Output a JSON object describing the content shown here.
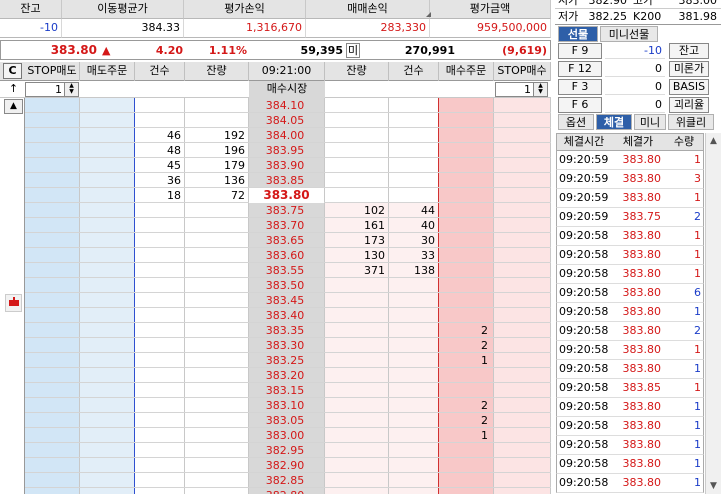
{
  "summary": {
    "headers": [
      "잔고",
      "이동평균가",
      "평가손익",
      "매매손익",
      "평가금액"
    ],
    "values": [
      "-10",
      "384.33",
      "1,316,670",
      "283,330",
      "959,500,000"
    ]
  },
  "price_line": {
    "price": "383.80",
    "arrow": "▲",
    "change": "4.20",
    "pct": "1.11%",
    "volume": "59,395",
    "volume_unit": "미",
    "open_interest": "270,991",
    "oi_change": "(9,619)"
  },
  "top_right": {
    "row1": [
      "시가",
      "382.90",
      "고가",
      "383.00"
    ],
    "row2": [
      "저가",
      "382.25",
      "K200",
      "381.98"
    ]
  },
  "order_table": {
    "c_button": "C",
    "headers": [
      "STOP매도",
      "매도주문",
      "건수",
      "잔량",
      "09:21:00",
      "잔량",
      "건수",
      "매수주문",
      "STOP매수"
    ],
    "stop_sell_qty": "1",
    "stop_buy_qty": "1",
    "market_label": "매수시장",
    "current_price": "383.80",
    "up_arrow": "↑",
    "triangle_up": "▲",
    "rows": [
      {
        "price": "384.10",
        "s_qty": "",
        "s_cnt": "",
        "b_qty": "",
        "b_cnt": "",
        "buy": ""
      },
      {
        "price": "384.05",
        "s_qty": "",
        "s_cnt": "",
        "b_qty": "",
        "b_cnt": "",
        "buy": ""
      },
      {
        "price": "384.00",
        "s_qty": "192",
        "s_cnt": "46",
        "b_qty": "",
        "b_cnt": "",
        "buy": ""
      },
      {
        "price": "383.95",
        "s_qty": "196",
        "s_cnt": "48",
        "b_qty": "",
        "b_cnt": "",
        "buy": ""
      },
      {
        "price": "383.90",
        "s_qty": "179",
        "s_cnt": "45",
        "b_qty": "",
        "b_cnt": "",
        "buy": ""
      },
      {
        "price": "383.85",
        "s_qty": "136",
        "s_cnt": "36",
        "b_qty": "",
        "b_cnt": "",
        "buy": ""
      },
      {
        "price": "383.80",
        "s_qty": "72",
        "s_cnt": "18",
        "b_qty": "",
        "b_cnt": "",
        "buy": ""
      },
      {
        "price": "383.75",
        "s_qty": "",
        "s_cnt": "",
        "b_qty": "102",
        "b_cnt": "44",
        "buy": ""
      },
      {
        "price": "383.70",
        "s_qty": "",
        "s_cnt": "",
        "b_qty": "161",
        "b_cnt": "40",
        "buy": ""
      },
      {
        "price": "383.65",
        "s_qty": "",
        "s_cnt": "",
        "b_qty": "173",
        "b_cnt": "30",
        "buy": ""
      },
      {
        "price": "383.60",
        "s_qty": "",
        "s_cnt": "",
        "b_qty": "130",
        "b_cnt": "33",
        "buy": ""
      },
      {
        "price": "383.55",
        "s_qty": "",
        "s_cnt": "",
        "b_qty": "371",
        "b_cnt": "138",
        "buy": ""
      },
      {
        "price": "383.50",
        "s_qty": "",
        "s_cnt": "",
        "b_qty": "",
        "b_cnt": "",
        "buy": ""
      },
      {
        "price": "383.45",
        "s_qty": "",
        "s_cnt": "",
        "b_qty": "",
        "b_cnt": "",
        "buy": ""
      },
      {
        "price": "383.40",
        "s_qty": "",
        "s_cnt": "",
        "b_qty": "",
        "b_cnt": "",
        "buy": ""
      },
      {
        "price": "383.35",
        "s_qty": "",
        "s_cnt": "",
        "b_qty": "",
        "b_cnt": "",
        "buy": "2"
      },
      {
        "price": "383.30",
        "s_qty": "",
        "s_cnt": "",
        "b_qty": "",
        "b_cnt": "",
        "buy": "2"
      },
      {
        "price": "383.25",
        "s_qty": "",
        "s_cnt": "",
        "b_qty": "",
        "b_cnt": "",
        "buy": "1"
      },
      {
        "price": "383.20",
        "s_qty": "",
        "s_cnt": "",
        "b_qty": "",
        "b_cnt": "",
        "buy": ""
      },
      {
        "price": "383.15",
        "s_qty": "",
        "s_cnt": "",
        "b_qty": "",
        "b_cnt": "",
        "buy": ""
      },
      {
        "price": "383.10",
        "s_qty": "",
        "s_cnt": "",
        "b_qty": "",
        "b_cnt": "",
        "buy": "2"
      },
      {
        "price": "383.05",
        "s_qty": "",
        "s_cnt": "",
        "b_qty": "",
        "b_cnt": "",
        "buy": "2"
      },
      {
        "price": "383.00",
        "s_qty": "",
        "s_cnt": "",
        "b_qty": "",
        "b_cnt": "",
        "buy": "1"
      },
      {
        "price": "382.95",
        "s_qty": "",
        "s_cnt": "",
        "b_qty": "",
        "b_cnt": "",
        "buy": ""
      },
      {
        "price": "382.90",
        "s_qty": "",
        "s_cnt": "",
        "b_qty": "",
        "b_cnt": "",
        "buy": ""
      },
      {
        "price": "382.85",
        "s_qty": "",
        "s_cnt": "",
        "b_qty": "",
        "b_cnt": "",
        "buy": ""
      },
      {
        "price": "382.80",
        "s_qty": "",
        "s_cnt": "",
        "b_qty": "",
        "b_cnt": "",
        "buy": ""
      }
    ]
  },
  "futures_panel": {
    "tabs": [
      "선물",
      "미니선물"
    ],
    "keys": [
      {
        "label": "F 9",
        "value": "-10",
        "button": "잔고"
      },
      {
        "label": "F 12",
        "value": "0",
        "button": "미론가"
      },
      {
        "label": "F 3",
        "value": "0",
        "button": "BASIS"
      },
      {
        "label": "F 6",
        "value": "0",
        "button": "괴리율"
      }
    ]
  },
  "trades_panel": {
    "tabs": [
      "옵션",
      "체결",
      "미니",
      "위클리"
    ],
    "headers": [
      "체결시간",
      "체결가",
      "수량"
    ],
    "rows": [
      {
        "time": "09:20:59",
        "price": "383.80",
        "qty": "1",
        "side": "buy"
      },
      {
        "time": "09:20:59",
        "price": "383.80",
        "qty": "3",
        "side": "buy"
      },
      {
        "time": "09:20:59",
        "price": "383.80",
        "qty": "1",
        "side": "buy"
      },
      {
        "time": "09:20:59",
        "price": "383.75",
        "qty": "2",
        "side": "sell"
      },
      {
        "time": "09:20:58",
        "price": "383.80",
        "qty": "1",
        "side": "buy"
      },
      {
        "time": "09:20:58",
        "price": "383.80",
        "qty": "1",
        "side": "buy"
      },
      {
        "time": "09:20:58",
        "price": "383.80",
        "qty": "1",
        "side": "buy"
      },
      {
        "time": "09:20:58",
        "price": "383.80",
        "qty": "6",
        "side": "sell"
      },
      {
        "time": "09:20:58",
        "price": "383.80",
        "qty": "1",
        "side": "sell"
      },
      {
        "time": "09:20:58",
        "price": "383.80",
        "qty": "2",
        "side": "sell"
      },
      {
        "time": "09:20:58",
        "price": "383.80",
        "qty": "1",
        "side": "buy"
      },
      {
        "time": "09:20:58",
        "price": "383.80",
        "qty": "1",
        "side": "sell"
      },
      {
        "time": "09:20:58",
        "price": "383.85",
        "qty": "1",
        "side": "buy"
      },
      {
        "time": "09:20:58",
        "price": "383.80",
        "qty": "1",
        "side": "sell"
      },
      {
        "time": "09:20:58",
        "price": "383.80",
        "qty": "1",
        "side": "sell"
      },
      {
        "time": "09:20:58",
        "price": "383.80",
        "qty": "1",
        "side": "sell"
      },
      {
        "time": "09:20:58",
        "price": "383.80",
        "qty": "1",
        "side": "sell"
      },
      {
        "time": "09:20:58",
        "price": "383.80",
        "qty": "1",
        "side": "sell"
      }
    ]
  },
  "colors": {
    "sell_bg": "#d2e6f6",
    "sell_order_bg": "#e2eef8",
    "buy_bg": "#fce4e4",
    "buy_order_bg": "#f8c8c8",
    "price_bg": "#d8d8d8",
    "current_price_bg": "#ffffff",
    "accent": "#2e5fa8"
  }
}
